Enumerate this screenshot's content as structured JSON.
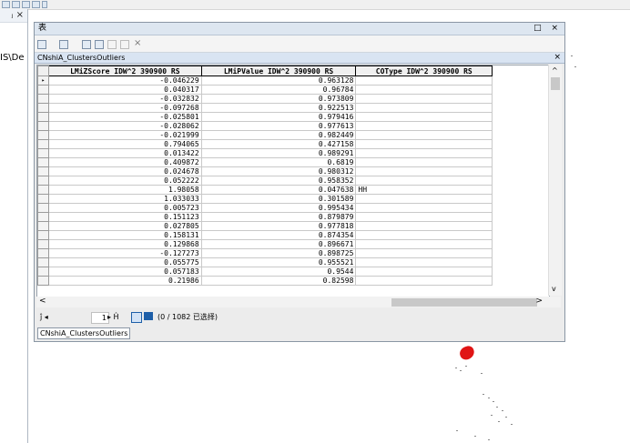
{
  "left_panel": {
    "pin_close": "ⱼ ×",
    "path_text": "IS\\De"
  },
  "window": {
    "title": "表",
    "controls": "□ ×",
    "layer_tab": "CNshiA_ClustersOutliers",
    "bottom_tab": "CNshiA_ClustersOutliers"
  },
  "columns": [
    "LMiZScore IDW^2 390900 RS",
    "LMiPValue IDW^2 390900 RS",
    "COType IDW^2 390900 RS"
  ],
  "rows": [
    [
      "-0.046229",
      "0.963128",
      ""
    ],
    [
      "0.040317",
      "0.96784",
      ""
    ],
    [
      "-0.032832",
      "0.973809",
      ""
    ],
    [
      "-0.097268",
      "0.922513",
      ""
    ],
    [
      "-0.025801",
      "0.979416",
      ""
    ],
    [
      "-0.028062",
      "0.977613",
      ""
    ],
    [
      "-0.021999",
      "0.982449",
      ""
    ],
    [
      "0.794065",
      "0.427158",
      ""
    ],
    [
      "0.013422",
      "0.989291",
      ""
    ],
    [
      "0.409872",
      "0.6819",
      ""
    ],
    [
      "0.024678",
      "0.980312",
      ""
    ],
    [
      "0.052222",
      "0.958352",
      ""
    ],
    [
      "1.98058",
      "0.047638",
      "HH"
    ],
    [
      "1.033033",
      "0.301589",
      ""
    ],
    [
      "0.005723",
      "0.995434",
      ""
    ],
    [
      "0.151123",
      "0.879879",
      ""
    ],
    [
      "0.027805",
      "0.977818",
      ""
    ],
    [
      "0.158131",
      "0.874354",
      ""
    ],
    [
      "0.129868",
      "0.896671",
      ""
    ],
    [
      "-0.127273",
      "0.898725",
      ""
    ],
    [
      "0.055775",
      "0.955521",
      ""
    ],
    [
      "0.057183",
      "0.9544",
      ""
    ],
    [
      "0.21986",
      "0.82598",
      ""
    ]
  ],
  "nav": {
    "first": "ĵ ◂",
    "page": "1",
    "next_last": "▸ Ĥ",
    "status": "(0 / 1082 已选择)"
  }
}
